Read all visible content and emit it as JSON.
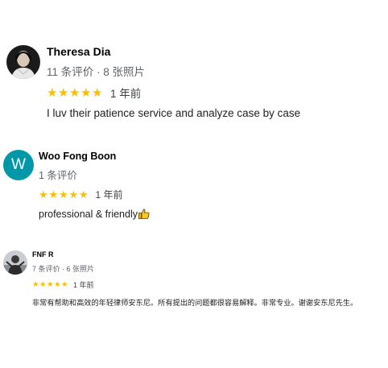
{
  "reviews": [
    {
      "reviewer_name": "Theresa Dia",
      "meta": "11 条评价 · 8 张照片",
      "rating": 5,
      "max_rating": 5,
      "date": "1 年前",
      "text": "I luv their patience service and analyze case by case",
      "avatar": "profile-photo"
    },
    {
      "reviewer_name": "Woo Fong Boon",
      "meta": "1 条评价",
      "rating": 5,
      "max_rating": 5,
      "date": "1 年前",
      "text": "professional & friendly",
      "avatar_letter": "W",
      "avatar_color": "#0097a7",
      "emoji": "thumbs-up-icon"
    },
    {
      "reviewer_name": "FNF R",
      "meta": "7 条评价 · 6 张照片",
      "rating": 5,
      "max_rating": 5,
      "date": "1 年前",
      "text": "非常有帮助和高效的年轻律师安东尼。所有提出的问题都很容易解释。非常专业。谢谢安东尼先生。",
      "avatar": "profile-photo"
    }
  ],
  "colors": {
    "star": "#fbbc04",
    "meta_text": "#5f6368",
    "body_text": "#202124"
  }
}
